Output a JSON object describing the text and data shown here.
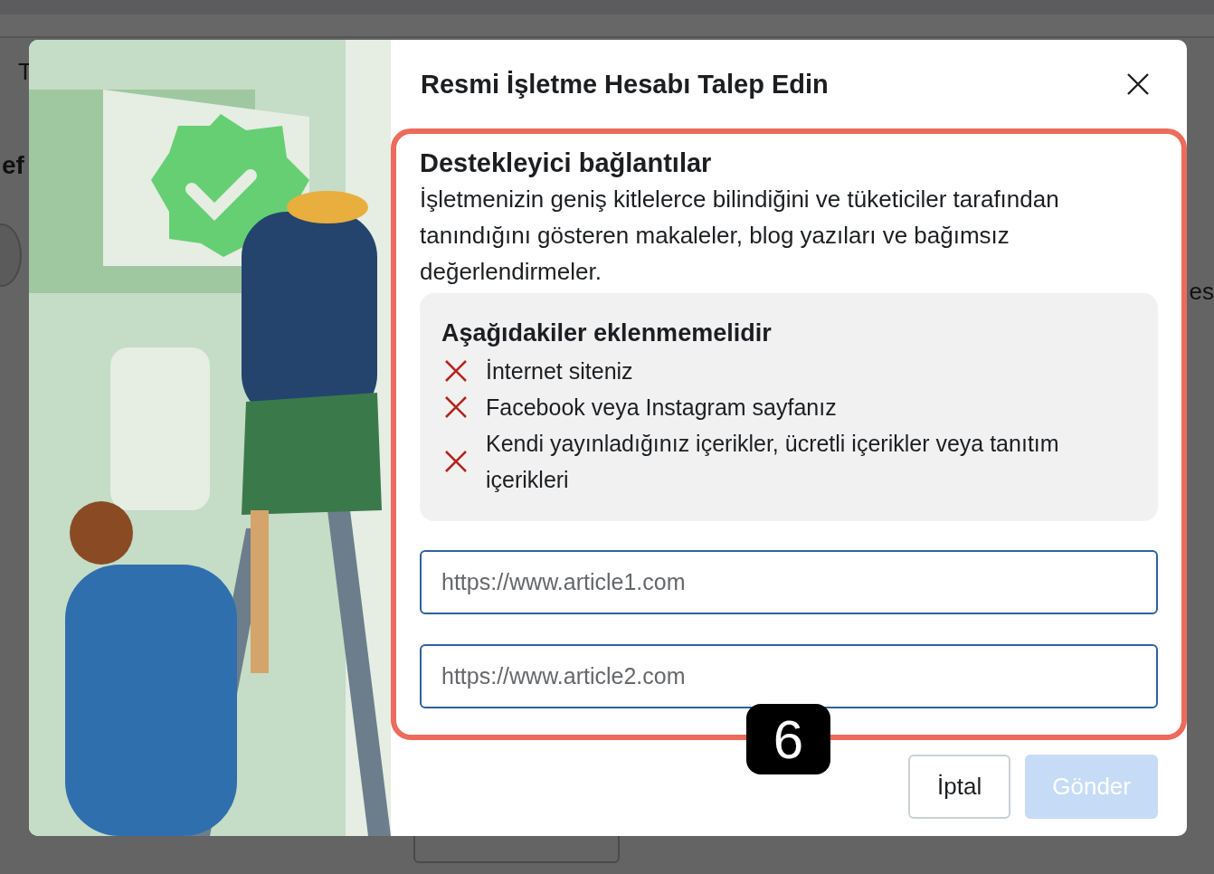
{
  "background_page": {
    "tab_label": "T",
    "sidebar_heading": "ef",
    "side_label": "es"
  },
  "dialog": {
    "title": "Resmi İşletme Hesabı Talep Edin",
    "section": {
      "highlighted": true,
      "heading": "Destekleyici bağlantılar",
      "description": "İşletmenizin geniş kitlelerce bilindiğini ve tüketiciler tarafından tanındığını gösteren makaleler, blog yazıları ve bağımsız değerlendirmeler.",
      "exclusions": {
        "heading": "Aşağıdakiler eklenmemelidir",
        "items": [
          {
            "text": "İnternet siteniz"
          },
          {
            "text": "Facebook veya Instagram sayfanız"
          },
          {
            "text": "Kendi yayınladığınız içerikler, ücretli içerikler veya tanıtım içerikleri"
          }
        ]
      },
      "link_fields": [
        {
          "placeholder": "https://www.article1.com"
        },
        {
          "placeholder": "https://www.article2.com"
        }
      ]
    },
    "step_badge": "6",
    "buttons": [
      {
        "label": "İptal",
        "kind": "secondary",
        "disabled": false
      },
      {
        "label": "Gönder",
        "kind": "primary",
        "disabled": true
      }
    ]
  }
}
